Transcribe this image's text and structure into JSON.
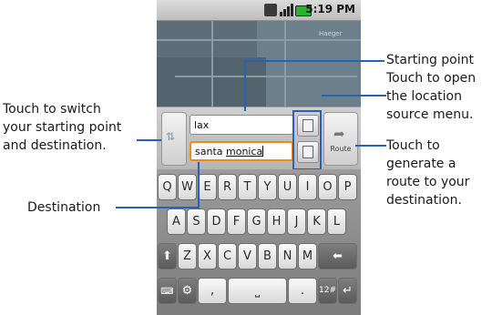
{
  "status_bar": {
    "time": "5:19 PM"
  },
  "map": {
    "place_label": "Haeger"
  },
  "route": {
    "start_value": "lax",
    "dest_value_prefix": "santa ",
    "dest_value_underlined": "monica",
    "route_button_label": "Route"
  },
  "keyboard": {
    "row1": [
      "Q",
      "W",
      "E",
      "R",
      "T",
      "Y",
      "U",
      "I",
      "O",
      "P"
    ],
    "row2": [
      "A",
      "S",
      "D",
      "F",
      "G",
      "H",
      "J",
      "K",
      "L"
    ],
    "row3": [
      "Z",
      "X",
      "C",
      "V",
      "B",
      "N",
      "M"
    ],
    "row4": {
      "comma": ",",
      "period": ".",
      "symbols": "12#"
    }
  },
  "callouts": {
    "swap": [
      "Touch to switch",
      "your starting point",
      "and destination."
    ],
    "destination": "Destination",
    "start": [
      "Starting point",
      "Touch to open",
      "the location",
      "source menu."
    ],
    "route": [
      "Touch to",
      "generate a",
      "route to your",
      "destination."
    ]
  },
  "colors": {
    "accent": "#2563b8",
    "focus": "#f28a1a",
    "battery": "#26b526"
  }
}
